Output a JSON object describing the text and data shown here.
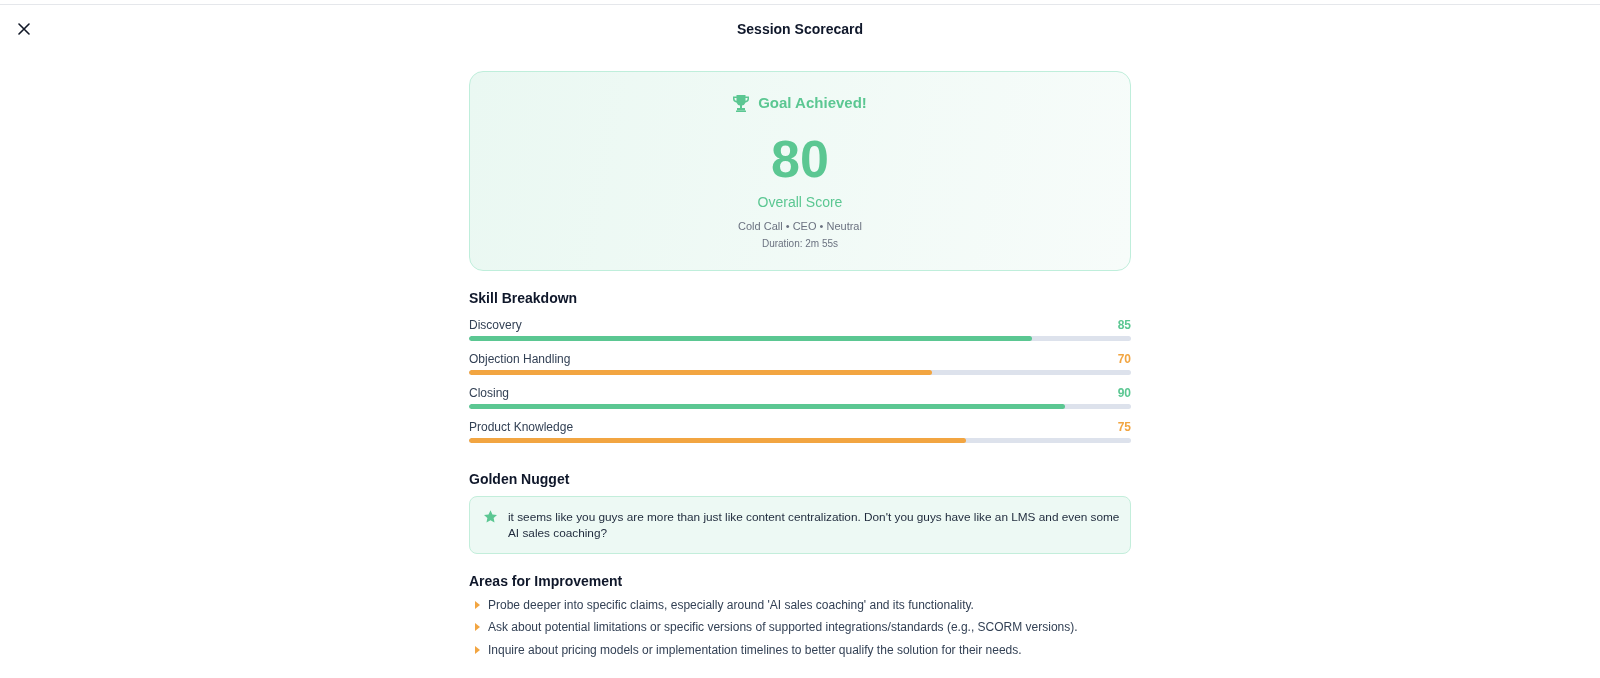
{
  "header": {
    "title": "Session Scorecard"
  },
  "result": {
    "status": "Goal Achieved!",
    "score": "80",
    "score_label": "Overall Score",
    "details": "Cold Call • CEO • Neutral",
    "duration": "Duration: 2m 55s"
  },
  "skill_breakdown": {
    "title": "Skill Breakdown",
    "skills": [
      {
        "name": "Discovery",
        "score": "85",
        "level": 0.85,
        "color": "#5bc792"
      },
      {
        "name": "Objection Handling",
        "score": "70",
        "level": 0.7,
        "color": "#f2a541"
      },
      {
        "name": "Closing",
        "score": "90",
        "level": 0.9,
        "color": "#5bc792"
      },
      {
        "name": "Product Knowledge",
        "score": "75",
        "level": 0.75,
        "color": "#f2a541"
      }
    ]
  },
  "golden_nugget": {
    "title": "Golden Nugget",
    "quote": "it seems like you guys are more than just like content centralization. Don't you guys have like an LMS and even some AI sales coaching?"
  },
  "areas_for_improvement": {
    "title": "Areas for Improvement",
    "items": [
      "Probe deeper into specific claims, especially around 'AI sales coaching' and its functionality.",
      "Ask about potential limitations or specific versions of supported integrations/standards (e.g., SCORM versions).",
      "Inquire about pricing models or implementation timelines to better qualify the solution for their needs."
    ]
  }
}
